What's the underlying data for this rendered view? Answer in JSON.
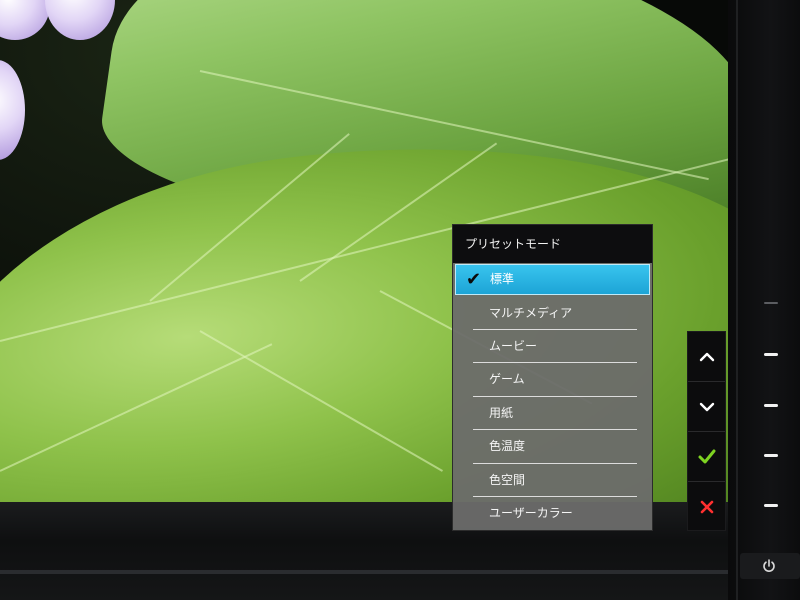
{
  "osd": {
    "title": "プリセットモード",
    "items": [
      {
        "label": "標準",
        "selected": true
      },
      {
        "label": "マルチメディア",
        "selected": false
      },
      {
        "label": "ムービー",
        "selected": false
      },
      {
        "label": "ゲーム",
        "selected": false
      },
      {
        "label": "用紙",
        "selected": false
      },
      {
        "label": "色温度",
        "selected": false
      },
      {
        "label": "色空間",
        "selected": false
      },
      {
        "label": "ユーザーカラー",
        "selected": false
      }
    ],
    "check_glyph": "✔",
    "accent_color": "#2bb4e2"
  },
  "key_guide": {
    "up_icon": "chevron-up-icon",
    "down_icon": "chevron-down-icon",
    "confirm_icon": "check-icon",
    "confirm_color": "#7ed321",
    "cancel_icon": "close-icon",
    "cancel_color": "#ff3030"
  },
  "hardware": {
    "power_icon": "power-icon"
  }
}
